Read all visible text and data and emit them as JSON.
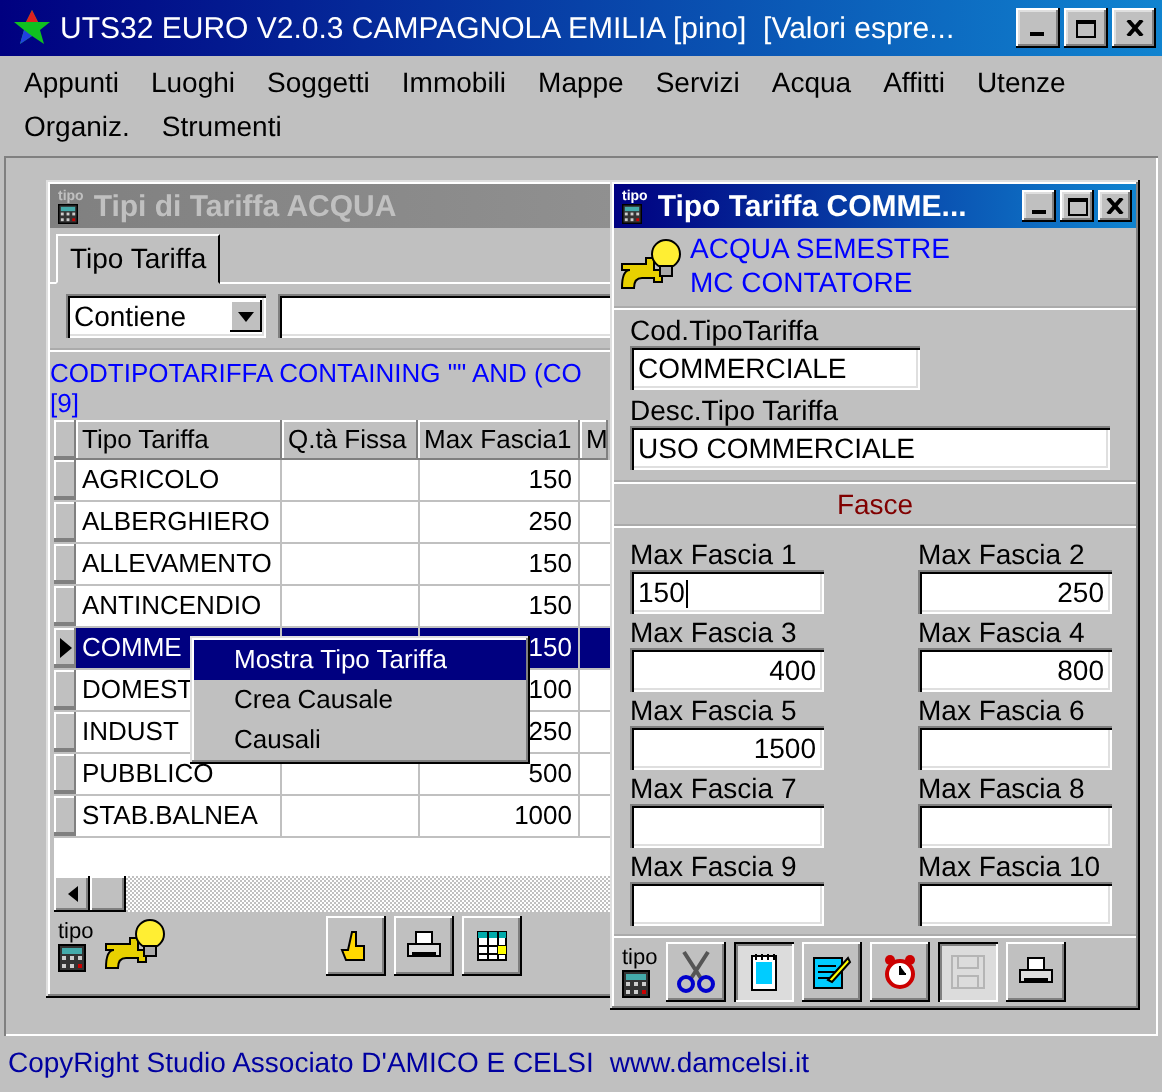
{
  "window": {
    "title": "UTS32 EURO V2.0.3 CAMPAGNOLA EMILIA [pino]  [Valori espre..."
  },
  "menu": [
    "Appunti",
    "Luoghi",
    "Soggetti",
    "Immobili",
    "Mappe",
    "Servizi",
    "Acqua",
    "Affitti",
    "Utenze",
    "Organiz.",
    "Strumenti"
  ],
  "list_window": {
    "title": "Tipi di Tariffa ACQUA",
    "icon_label": "tipo",
    "active": false,
    "tabs": [
      {
        "label": "Tipo Tariffa",
        "selected": true
      }
    ],
    "filter": {
      "operator": "Contiene"
    },
    "query": "CODTIPOTARIFFA CONTAINING \"\" AND (CO",
    "count": "[9]",
    "table": {
      "columns": [
        "Tipo Tariffa",
        "Q.tà Fissa",
        "Max Fascia1",
        "M"
      ],
      "rows": [
        {
          "cells": [
            "AGRICOLO",
            "",
            "150",
            ""
          ],
          "selected": false
        },
        {
          "cells": [
            "ALBERGHIERO",
            "",
            "250",
            ""
          ],
          "selected": false
        },
        {
          "cells": [
            "ALLEVAMENTO",
            "",
            "150",
            ""
          ],
          "selected": false
        },
        {
          "cells": [
            "ANTINCENDIO",
            "",
            "150",
            ""
          ],
          "selected": false
        },
        {
          "cells": [
            "COMME",
            "",
            "150",
            ""
          ],
          "selected": true
        },
        {
          "cells": [
            "DOMEST",
            "",
            "100",
            ""
          ],
          "selected": false
        },
        {
          "cells": [
            "INDUST",
            "",
            "250",
            ""
          ],
          "selected": false
        },
        {
          "cells": [
            "PUBBLICO",
            "",
            "500",
            ""
          ],
          "selected": false
        },
        {
          "cells": [
            "STAB.BALNEA",
            "",
            "1000",
            ""
          ],
          "selected": false
        }
      ]
    },
    "context_menu": [
      {
        "label": "Mostra Tipo Tariffa",
        "selected": true
      },
      {
        "label": "Crea Causale",
        "selected": false
      },
      {
        "label": "Causali",
        "selected": false
      }
    ],
    "toolbar_label": "tipo",
    "toolbar": [
      {
        "kind": "hand",
        "pressed": false,
        "disabled": false
      },
      {
        "kind": "printer",
        "pressed": false,
        "disabled": false
      },
      {
        "kind": "grid",
        "pressed": false,
        "disabled": false
      }
    ]
  },
  "detail_window": {
    "title": "Tipo Tariffa COMME...",
    "icon_label": "tipo",
    "active": true,
    "header_lines": [
      "ACQUA SEMESTRE",
      "MC CONTATORE"
    ],
    "fields": [
      {
        "label": "Cod.TipoTariffa",
        "value": "COMMERCIALE",
        "kind": "short"
      },
      {
        "label": "Desc.Tipo Tariffa",
        "value": "USO COMMERCIALE",
        "kind": "long"
      }
    ],
    "section": "Fasce",
    "bands": [
      {
        "label": "Max Fascia 1",
        "value": "150",
        "editing": true
      },
      {
        "label": "Max Fascia 2",
        "value": "250",
        "editing": false
      },
      {
        "label": "Max Fascia 3",
        "value": "400",
        "editing": false
      },
      {
        "label": "Max Fascia 4",
        "value": "800",
        "editing": false
      },
      {
        "label": "Max Fascia 5",
        "value": "1500",
        "editing": false
      },
      {
        "label": "Max Fascia 6",
        "editing": false
      },
      {
        "label": "Max Fascia 7",
        "editing": false
      },
      {
        "label": "Max Fascia 8",
        "editing": false
      },
      {
        "label": "Max Fascia 9",
        "editing": false
      },
      {
        "label": "Max Fascia 10",
        "editing": false
      }
    ],
    "toolbar_label": "tipo",
    "toolbar": [
      {
        "kind": "scissors",
        "pressed": false,
        "disabled": false
      },
      {
        "kind": "notepad",
        "pressed": true,
        "disabled": false
      },
      {
        "kind": "notepad-pencil",
        "pressed": false,
        "disabled": false
      },
      {
        "kind": "alarm-clock",
        "pressed": false,
        "disabled": false
      },
      {
        "kind": "floppy",
        "pressed": true,
        "disabled": true
      },
      {
        "kind": "printer",
        "pressed": false,
        "disabled": false
      }
    ]
  },
  "status_bar": {
    "copyright": "CopyRight Studio Associato D'AMICO E CELSI",
    "website": "www.damcelsi.it"
  }
}
